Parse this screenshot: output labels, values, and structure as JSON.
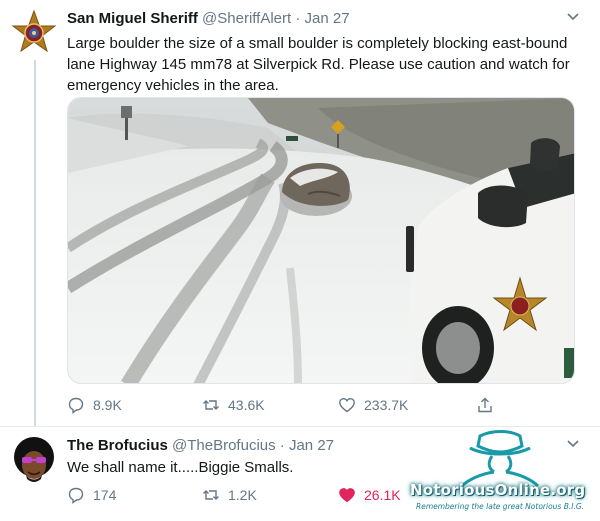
{
  "tweets": [
    {
      "name": "San Miguel Sheriff",
      "handle": "@SheriffAlert",
      "time": "Jan 27",
      "text": "Large boulder the size of a small boulder is completely blocking east-bound lane Highway 145 mm78 at Silverpick Rd. Please use caution and watch for emergency vehicles in the area.",
      "replies": "8.9K",
      "retweets": "43.6K",
      "likes": "233.7K"
    },
    {
      "name": "The Brofucius",
      "handle": "@TheBrofucius",
      "time": "Jan 27",
      "text": "We shall name it.....Biggie Smalls.",
      "replies": "174",
      "retweets": "1.2K",
      "likes": "26.1K"
    }
  ],
  "separator": "·",
  "watermark": {
    "title": "NotoriousOnline.org",
    "subtitle": "Remembering the late great Notorious B.I.G."
  },
  "colors": {
    "text": "#14171a",
    "muted": "#657786",
    "like_active": "#e0245e",
    "watermark": "#1a9aa8"
  }
}
